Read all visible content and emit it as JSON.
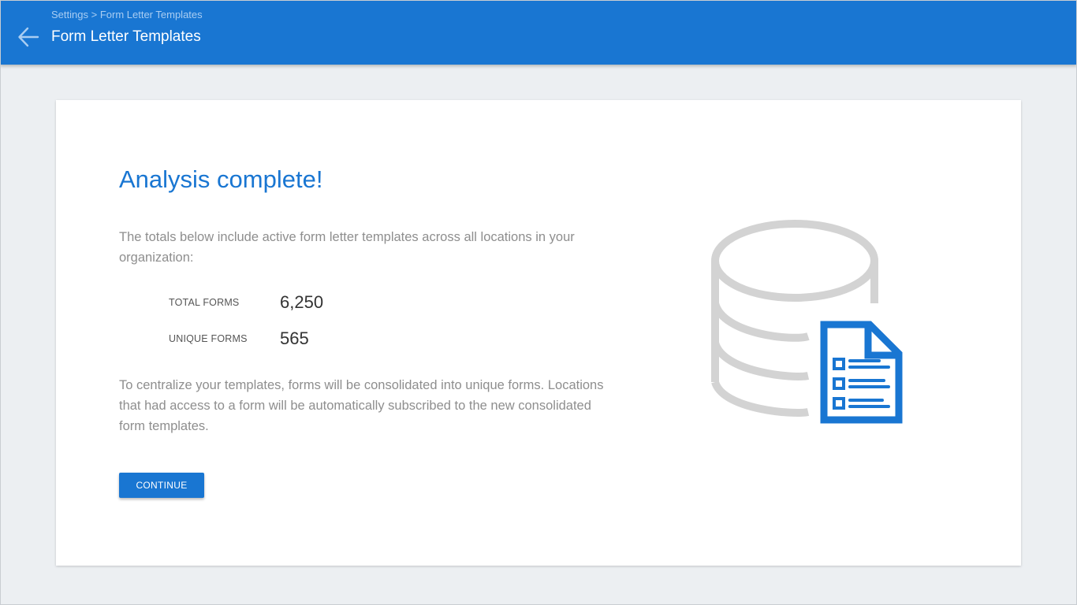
{
  "header": {
    "breadcrumb": {
      "parent": "Settings",
      "separator": ">",
      "current": "Form Letter Templates"
    },
    "title": "Form Letter Templates",
    "back_icon": "arrow-left-icon"
  },
  "card": {
    "headline": "Analysis complete!",
    "intro": "The totals below include active form letter templates across all locations in your organization:",
    "stats": [
      {
        "label": "TOTAL FORMS",
        "value": "6,250"
      },
      {
        "label": "UNIQUE FORMS",
        "value": "565"
      }
    ],
    "body": "To centralize your templates, forms will be consolidated into unique forms. Locations that had access to a form will be automatically subscribed to the new consolidated form templates.",
    "continue_label": "CONTINUE",
    "illustration_icon": "database-document-icon"
  },
  "colors": {
    "primary": "#1976d2",
    "background": "#eceff2",
    "card": "#ffffff",
    "muted_text": "#8e8e8e",
    "illustration_gray": "#d3d3d3"
  }
}
